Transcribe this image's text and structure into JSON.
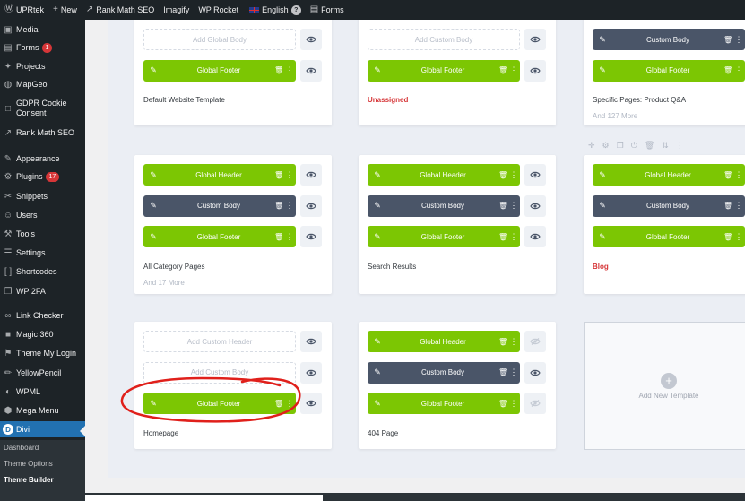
{
  "admin_bar": {
    "items": [
      {
        "icon": "wordpress-logo-icon",
        "glyph": "Ⓦ",
        "label": "UPRtek"
      },
      {
        "icon": "plus-icon",
        "glyph": "+",
        "label": "New"
      },
      {
        "icon": "rank-math-icon",
        "glyph": "↗",
        "label": "Rank Math SEO"
      },
      {
        "icon": "",
        "glyph": "",
        "label": "Imagify"
      },
      {
        "icon": "",
        "glyph": "",
        "label": "WP Rocket"
      },
      {
        "icon": "uk-flag-icon",
        "glyph": "",
        "label": "English"
      },
      {
        "icon": "forms-icon",
        "glyph": "▤",
        "label": "Forms"
      }
    ],
    "english_badge": "?"
  },
  "sidebar": {
    "items": [
      {
        "label": "Media",
        "icon": "media-icon",
        "glyph": "▣"
      },
      {
        "label": "Forms",
        "icon": "forms-icon",
        "glyph": "▤",
        "badge": "1"
      },
      {
        "label": "Projects",
        "icon": "pin-icon",
        "glyph": "✦"
      },
      {
        "label": "MapGeo",
        "icon": "map-icon",
        "glyph": "◍"
      },
      {
        "label": "GDPR Cookie Consent",
        "icon": "cookie-icon",
        "glyph": "□"
      },
      {
        "label": "Rank Math SEO",
        "icon": "rank-math-icon",
        "glyph": "↗"
      },
      {
        "label": "Appearance",
        "icon": "brush-icon",
        "glyph": "✎"
      },
      {
        "label": "Plugins",
        "icon": "plugin-icon",
        "glyph": "⚙",
        "badge": "17"
      },
      {
        "label": "Snippets",
        "icon": "snippets-icon",
        "glyph": "✂"
      },
      {
        "label": "Users",
        "icon": "users-icon",
        "glyph": "☺"
      },
      {
        "label": "Tools",
        "icon": "wrench-icon",
        "glyph": "⚒"
      },
      {
        "label": "Settings",
        "icon": "settings-icon",
        "glyph": "☰"
      },
      {
        "label": "Shortcodes",
        "icon": "shortcodes-icon",
        "glyph": "[ ]"
      },
      {
        "label": "WP 2FA",
        "icon": "wp2fa-icon",
        "glyph": "❐"
      },
      {
        "label": "Link Checker",
        "icon": "link-icon",
        "glyph": "∞"
      },
      {
        "label": "Magic 360",
        "icon": "magic360-icon",
        "glyph": "■"
      },
      {
        "label": "Theme My Login",
        "icon": "key-icon",
        "glyph": "⚑"
      },
      {
        "label": "YellowPencil",
        "icon": "pencil-icon",
        "glyph": "✏"
      },
      {
        "label": "WPML",
        "icon": "wpml-icon",
        "glyph": "◐"
      },
      {
        "label": "Mega Menu",
        "icon": "mega-menu-icon",
        "glyph": "⬢"
      },
      {
        "label": "Divi",
        "icon": "divi-logo-icon",
        "glyph": "D"
      }
    ],
    "submenu": [
      "Dashboard",
      "Theme Options",
      "Theme Builder"
    ]
  },
  "templates": [
    {
      "rows": [
        {
          "label": "Add Global Body",
          "style": "empty",
          "visible": true
        },
        {
          "label": "Global Footer",
          "style": "green",
          "visible": true
        }
      ],
      "title": "Default Website Template",
      "title_red": false,
      "more": ""
    },
    {
      "rows": [
        {
          "label": "Add Custom Body",
          "style": "empty",
          "visible": true
        },
        {
          "label": "Global Footer",
          "style": "green",
          "visible": true
        }
      ],
      "title": "Unassigned",
      "title_red": true,
      "more": ""
    },
    {
      "rows": [
        {
          "label": "Custom Body",
          "style": "dark",
          "visible": true
        },
        {
          "label": "Global Footer",
          "style": "green",
          "visible": true
        }
      ],
      "title": "Specific Pages: Product Q&A",
      "title_red": false,
      "more": "And 127 More"
    },
    {
      "rows": [
        {
          "label": "Global Header",
          "style": "green",
          "visible": true
        },
        {
          "label": "Custom Body",
          "style": "dark",
          "visible": true
        },
        {
          "label": "Global Footer",
          "style": "green",
          "visible": true
        }
      ],
      "title": "All Category Pages",
      "title_red": false,
      "more": "And 17 More"
    },
    {
      "rows": [
        {
          "label": "Global Header",
          "style": "green",
          "visible": true
        },
        {
          "label": "Custom Body",
          "style": "dark",
          "visible": true
        },
        {
          "label": "Global Footer",
          "style": "green",
          "visible": true
        }
      ],
      "title": "Search Results",
      "title_red": false,
      "more": ""
    },
    {
      "rows": [
        {
          "label": "Global Header",
          "style": "green",
          "visible": true
        },
        {
          "label": "Custom Body",
          "style": "dark",
          "visible": true
        },
        {
          "label": "Global Footer",
          "style": "green",
          "visible": true
        }
      ],
      "title": "Blog",
      "title_red": true,
      "more": ""
    },
    {
      "rows": [
        {
          "label": "Add Custom Header",
          "style": "empty",
          "visible": true
        },
        {
          "label": "Add Custom Body",
          "style": "empty",
          "visible": true
        },
        {
          "label": "Global Footer",
          "style": "green",
          "visible": true
        }
      ],
      "title": "Homepage",
      "title_red": false,
      "more": ""
    },
    {
      "rows": [
        {
          "label": "Global Header",
          "style": "green",
          "visible": false
        },
        {
          "label": "Custom Body",
          "style": "dark",
          "visible": true
        },
        {
          "label": "Global Footer",
          "style": "green",
          "visible": false
        }
      ],
      "title": "404 Page",
      "title_red": false,
      "more": ""
    }
  ],
  "add_template_label": "Add New Template",
  "card_toolbar_icons": [
    "move-icon",
    "gear-icon",
    "copy-icon",
    "power-icon",
    "trash-icon",
    "sort-icon",
    "dots-icon"
  ],
  "colors": {
    "green": "#7cc603",
    "dark": "#4a5568",
    "accent_red": "#d63638",
    "annotation_red": "#e0201b",
    "wp_blue": "#2271b1"
  }
}
